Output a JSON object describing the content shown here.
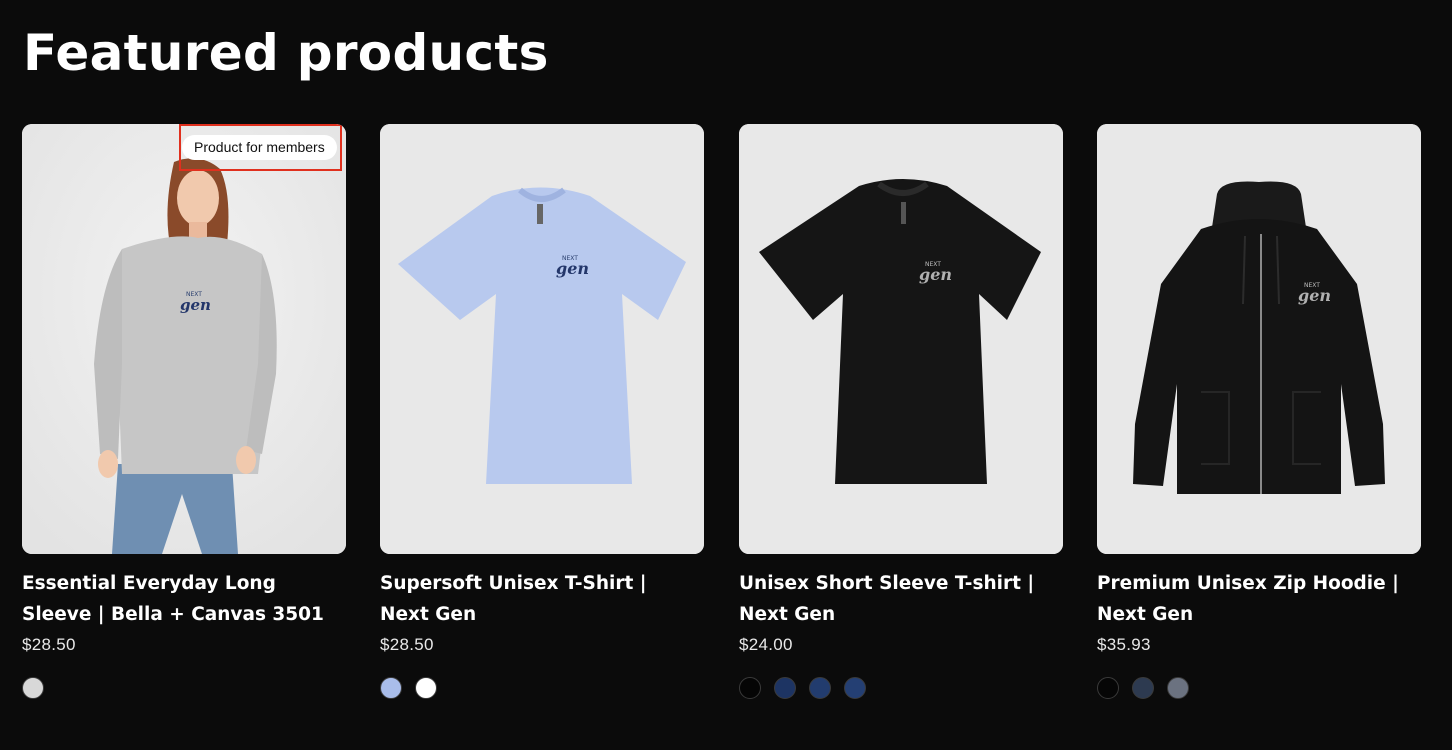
{
  "section": {
    "title": "Featured products"
  },
  "products": [
    {
      "title": "Essential Everyday Long Sleeve | Bella + Canvas 3501",
      "price": "$28.50",
      "badge": "Product for members",
      "logo_top": "NEXT",
      "logo_main": "gen",
      "swatches": [
        "#d8d8d8"
      ]
    },
    {
      "title": "Supersoft Unisex T-Shirt | Next Gen",
      "price": "$28.50",
      "logo_top": "NEXT",
      "logo_main": "gen",
      "swatches": [
        "#a9bdea",
        "#ffffff"
      ]
    },
    {
      "title": "Unisex Short Sleeve T-shirt | Next Gen",
      "price": "$24.00",
      "logo_top": "NEXT",
      "logo_main": "gen",
      "swatches": [
        "#050505",
        "#1d3463",
        "#223c6e",
        "#243f73"
      ]
    },
    {
      "title": "Premium Unisex Zip Hoodie | Next Gen",
      "price": "$35.93",
      "logo_top": "NEXT",
      "logo_main": "gen",
      "swatches": [
        "#060606",
        "#2d3a50",
        "#6b7280"
      ]
    }
  ]
}
